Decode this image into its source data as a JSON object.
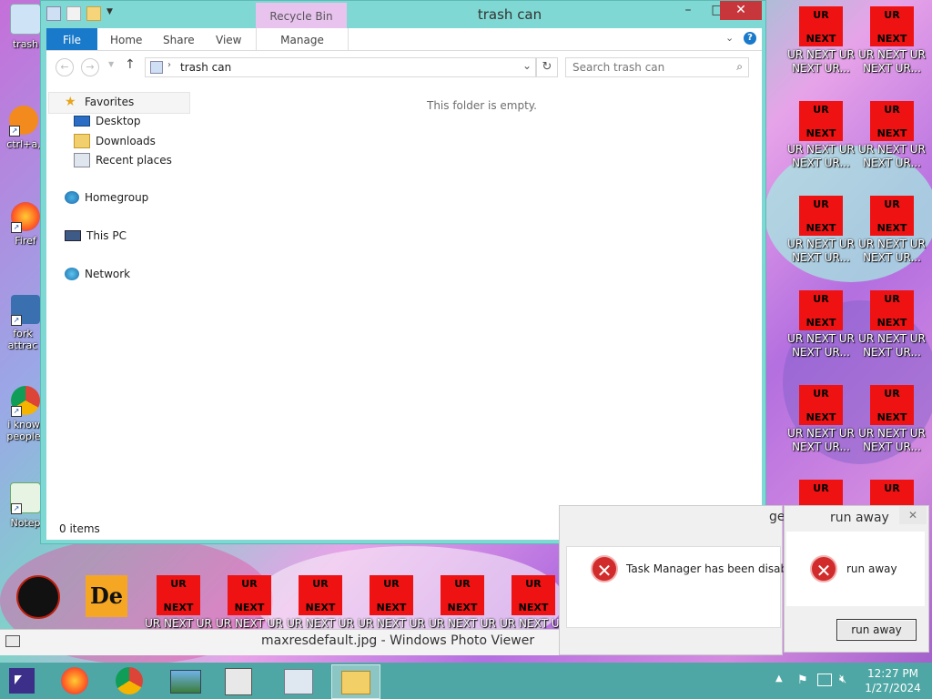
{
  "desktop": {
    "left_labels": [
      "trash",
      "ctrl+a,",
      "Firef",
      "fork attrac",
      "i know people",
      "Notep"
    ],
    "tile_top": "UR",
    "tile_bottom": "NEXT",
    "tile_caption_1": "UR NEXT UR",
    "tile_caption_2": "NEXT UR..."
  },
  "explorer": {
    "title": "trash can",
    "context_tab": "Recycle Bin Tools",
    "tabs": {
      "file": "File",
      "home": "Home",
      "share": "Share",
      "view": "View",
      "manage": "Manage"
    },
    "address": "trash can",
    "search_placeholder": "Search trash can",
    "nav": {
      "favorites": "Favorites",
      "desktop": "Desktop",
      "downloads": "Downloads",
      "recent": "Recent places",
      "homegroup": "Homegroup",
      "thispc": "This PC",
      "network": "Network"
    },
    "empty_message": "This folder is empty.",
    "status": "0 items"
  },
  "task_manager_error": {
    "title_fragment": "ge",
    "message": "Task Manager has been disabled"
  },
  "run_away_dialog": {
    "title": "run away",
    "message": "run away",
    "button": "run away"
  },
  "photo_viewer": {
    "title": "maxresdefault.jpg - Windows Photo Viewer"
  },
  "taskbar": {
    "time": "12:27 PM",
    "date": "1/27/2024"
  }
}
